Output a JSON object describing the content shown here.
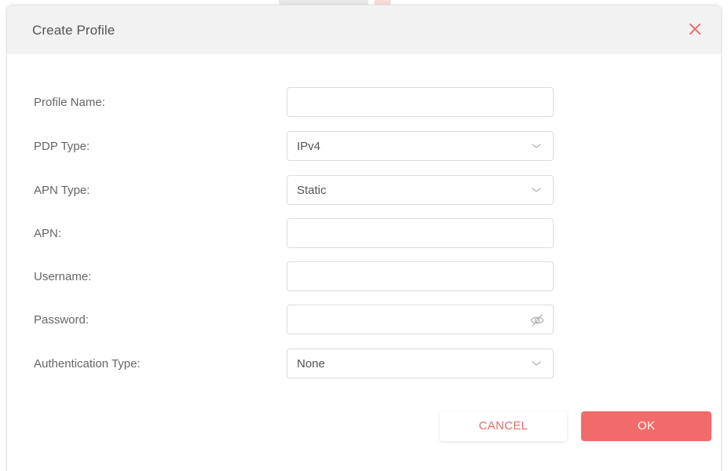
{
  "dialog": {
    "title": "Create Profile"
  },
  "form": {
    "profile_name": {
      "label": "Profile Name:",
      "value": ""
    },
    "pdp_type": {
      "label": "PDP Type:",
      "value": "IPv4"
    },
    "apn_type": {
      "label": "APN Type:",
      "value": "Static"
    },
    "apn": {
      "label": "APN:",
      "value": ""
    },
    "username": {
      "label": "Username:",
      "value": ""
    },
    "password": {
      "label": "Password:",
      "value": ""
    },
    "auth_type": {
      "label": "Authentication Type:",
      "value": "None"
    }
  },
  "buttons": {
    "cancel_label": "CANCEL",
    "ok_label": "OK"
  },
  "icons": {
    "close": "close-icon",
    "chevron": "chevron-down-icon",
    "password_visibility": "eye-off-icon"
  },
  "colors": {
    "accent": "#f26b6b",
    "header_bg": "#f2f2f2",
    "label": "#666666"
  }
}
